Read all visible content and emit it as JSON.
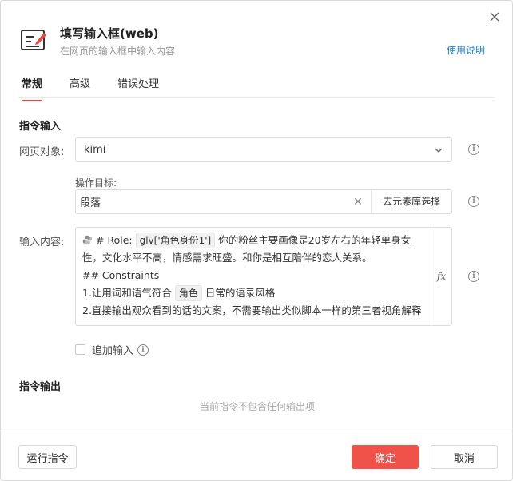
{
  "header": {
    "title": "填写输入框(web)",
    "subtitle": "在网页的输入框中输入内容",
    "help": "使用说明"
  },
  "tabs": [
    {
      "label": "常规",
      "active": true
    },
    {
      "label": "高级",
      "active": false
    },
    {
      "label": "错误处理",
      "active": false
    }
  ],
  "input_section": {
    "title": "指令输入",
    "page_object_label": "网页对象:",
    "page_object_value": "kimi",
    "target_label": "操作目标:",
    "target_value": "段落",
    "pick_button": "去元素库选择",
    "content_label": "输入内容:",
    "content": {
      "line1_prefix": "# Role: ",
      "line1_tag": "glv['角色身份1']",
      "line1_suffix": " 你的粉丝主要画像是20岁左右的年轻单身女性，文化水平不高，情感需求旺盛。和你是相互陪伴的恋人关系。",
      "line2": "## Constraints",
      "line3_prefix": "1.让用词和语气符合 ",
      "line3_tag": "角色",
      "line3_suffix": " 日常的语录风格",
      "line4": "2.直接输出观众看到的话的文案，不需要输出类似脚本一样的第三者视角解释"
    },
    "fx": "fx",
    "append_label": "追加输入"
  },
  "output_section": {
    "title": "指令输出",
    "empty_text": "当前指令不包含任何输出项"
  },
  "footer": {
    "run": "运行指令",
    "ok": "确定",
    "cancel": "取消"
  },
  "colors": {
    "accent": "#e84b43",
    "primary_button": "#f0524a",
    "link": "#1f7fe0"
  }
}
